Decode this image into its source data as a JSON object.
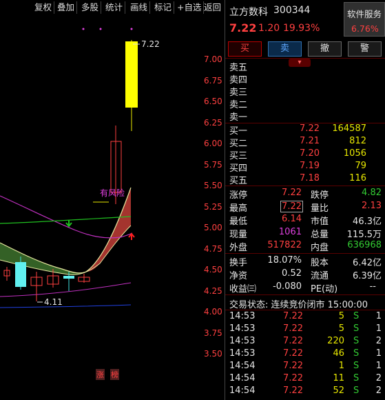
{
  "toolbar": {
    "items": [
      "复权",
      "叠加",
      "多股",
      "统计",
      "画线",
      "标记",
      "+自选",
      "返回"
    ]
  },
  "chart": {
    "y_axis": [
      "7.00",
      "6.75",
      "6.50",
      "6.25",
      "6.00",
      "5.75",
      "5.50",
      "5.25",
      "5.00",
      "4.75",
      "4.50",
      "4.25",
      "4.00",
      "3.75",
      "3.50"
    ],
    "high_label": "7.22",
    "low_label": "4.11",
    "risk_label": "有风险",
    "badge_zhang": "涨",
    "badge_bang": "榜"
  },
  "stock": {
    "name": "立方数科",
    "code": "300344",
    "price": "7.22",
    "change": "1.20",
    "change_pct": "19.93%",
    "sector": "软件服务",
    "sector_pct": "6.76%"
  },
  "buttons": {
    "buy": "买",
    "sell": "卖",
    "cancel": "撤",
    "alert": "警"
  },
  "ask": [
    {
      "label": "卖五",
      "price": "",
      "vol": ""
    },
    {
      "label": "卖四",
      "price": "",
      "vol": ""
    },
    {
      "label": "卖三",
      "price": "",
      "vol": ""
    },
    {
      "label": "卖二",
      "price": "",
      "vol": ""
    },
    {
      "label": "卖一",
      "price": "",
      "vol": ""
    }
  ],
  "bid": [
    {
      "label": "买一",
      "price": "7.22",
      "vol": "164587"
    },
    {
      "label": "买二",
      "price": "7.21",
      "vol": "812"
    },
    {
      "label": "买三",
      "price": "7.20",
      "vol": "1056"
    },
    {
      "label": "买四",
      "price": "7.19",
      "vol": "79"
    },
    {
      "label": "买五",
      "price": "7.18",
      "vol": "116"
    }
  ],
  "stats1": [
    {
      "l1": "涨停",
      "v1": "7.22",
      "l2": "跌停",
      "v2": "4.82"
    },
    {
      "l1": "最高",
      "v1": "7.22",
      "l2": "量比",
      "v2": "2.13"
    },
    {
      "l1": "最低",
      "v1": "6.14",
      "l2": "市值",
      "v2": "46.3亿"
    },
    {
      "l1": "现量",
      "v1": "1061",
      "l2": "总量",
      "v2": "115.5万"
    },
    {
      "l1": "外盘",
      "v1": "517822",
      "l2": "内盘",
      "v2": "636968"
    }
  ],
  "stats2": [
    {
      "l1": "换手",
      "v1": "18.07%",
      "l2": "股本",
      "v2": "6.42亿"
    },
    {
      "l1": "净资",
      "v1": "0.52",
      "l2": "流通",
      "v2": "6.39亿"
    },
    {
      "l1": "收益㈢",
      "v1": "-0.080",
      "l2": "PE(动)",
      "v2": "--"
    }
  ],
  "status": "交易状态: 连续竞价闭市 15:00:00",
  "ticks": [
    {
      "time": "14:53",
      "price": "7.22",
      "vol": "5",
      "side": "S",
      "n": "1"
    },
    {
      "time": "14:53",
      "price": "7.22",
      "vol": "5",
      "side": "S",
      "n": "1"
    },
    {
      "time": "14:53",
      "price": "7.22",
      "vol": "220",
      "side": "S",
      "n": "2"
    },
    {
      "time": "14:53",
      "price": "7.22",
      "vol": "46",
      "side": "S",
      "n": "1"
    },
    {
      "time": "14:54",
      "price": "7.22",
      "vol": "1",
      "side": "S",
      "n": "1"
    },
    {
      "time": "14:54",
      "price": "7.22",
      "vol": "11",
      "side": "S",
      "n": "2"
    },
    {
      "time": "14:54",
      "price": "7.22",
      "vol": "52",
      "side": "S",
      "n": "2"
    }
  ]
}
